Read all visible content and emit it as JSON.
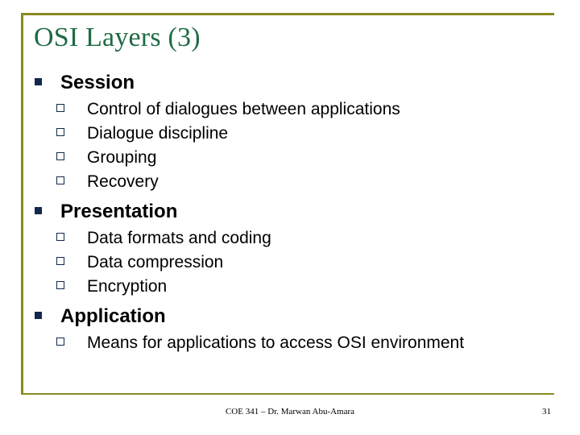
{
  "slide": {
    "title": "OSI Layers (3)",
    "accent_color": "#8a8a22",
    "title_color": "#1f6b43",
    "bullet_color": "#12284c",
    "sections": [
      {
        "heading": "Session",
        "items": [
          "Control of dialogues between applications",
          "Dialogue discipline",
          "Grouping",
          "Recovery"
        ]
      },
      {
        "heading": "Presentation",
        "items": [
          "Data formats and coding",
          "Data compression",
          "Encryption"
        ]
      },
      {
        "heading": "Application",
        "items": [
          "Means for applications to access OSI environment"
        ]
      }
    ],
    "footer": "COE 341 – Dr. Marwan Abu-Amara",
    "page_number": "31"
  }
}
